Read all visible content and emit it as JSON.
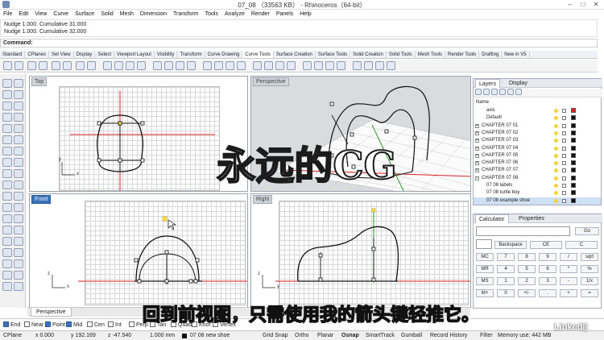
{
  "window": {
    "title": "07_08 （33563 KB） - Rhinoceros（64-bit）",
    "minimize": "–",
    "maximize": "□",
    "close": "✕"
  },
  "menu": [
    "File",
    "Edit",
    "View",
    "Curve",
    "Surface",
    "Solid",
    "Mesh",
    "Dimension",
    "Transform",
    "Tools",
    "Analyze",
    "Render",
    "Panels",
    "Help"
  ],
  "history": [
    "Nudge 1.000. Cumulative 31.000",
    "Nudge 1.000. Cumulative 32.000"
  ],
  "command": {
    "label": "Command:"
  },
  "tabs": [
    "Standard",
    "CPlanes",
    "Set View",
    "Display",
    "Select",
    "Viewport Layout",
    "Visibility",
    "Transform",
    "Curve Drawing",
    "Curve Tools",
    "Surface Creation",
    "Surface Tools",
    "Solid Creation",
    "Solid Tools",
    "Mesh Tools",
    "Render Tools",
    "Drafting",
    "New in V5"
  ],
  "active_tab": "Curve Tools",
  "viewports": {
    "top": "Top",
    "perspective": "Perspective",
    "front": "Front",
    "right": "Right"
  },
  "axis_labels": {
    "x": "x",
    "y": "y",
    "z": "z"
  },
  "viewport_tab": "Perspective",
  "layers_panel": {
    "tabs": [
      "Layers",
      "Display"
    ],
    "header": "Name",
    "rows": [
      {
        "name": "axis",
        "color": "#e81c1c",
        "sel": false,
        "indent": true,
        "expand": ""
      },
      {
        "name": "Default",
        "color": "#111111",
        "sel": false,
        "indent": true,
        "expand": ""
      },
      {
        "name": "CHAPTER 07 01",
        "color": "#111111",
        "sel": false,
        "indent": false,
        "expand": "+"
      },
      {
        "name": "CHAPTER 07 02",
        "color": "#111111",
        "sel": false,
        "indent": false,
        "expand": "+"
      },
      {
        "name": "CHAPTER 07 03",
        "color": "#111111",
        "sel": false,
        "indent": false,
        "expand": "+"
      },
      {
        "name": "CHAPTER 07 04",
        "color": "#111111",
        "sel": false,
        "indent": false,
        "expand": "+"
      },
      {
        "name": "CHAPTER 07 05",
        "color": "#111111",
        "sel": false,
        "indent": false,
        "expand": "+"
      },
      {
        "name": "CHAPTER 07 06",
        "color": "#111111",
        "sel": false,
        "indent": false,
        "expand": "+"
      },
      {
        "name": "CHAPTER 07 07",
        "color": "#111111",
        "sel": false,
        "indent": false,
        "expand": "+"
      },
      {
        "name": "CHAPTER 07 08",
        "color": "#111111",
        "sel": false,
        "indent": false,
        "expand": "−"
      },
      {
        "name": "07 08 labels",
        "color": "#111111",
        "sel": false,
        "indent": true,
        "expand": ""
      },
      {
        "name": "07 08 turtle boy",
        "color": "#111111",
        "sel": false,
        "indent": true,
        "expand": ""
      },
      {
        "name": "07 08 example shoe",
        "color": "#111111",
        "sel": true,
        "indent": true,
        "expand": ""
      }
    ]
  },
  "calc_panel": {
    "tabs": [
      "Calculator",
      "Properties"
    ],
    "go": "Go",
    "buttons": [
      [
        "Backspace",
        "CE",
        "C"
      ],
      [
        "MC",
        "7",
        "8",
        "9",
        "/",
        "sqrt"
      ],
      [
        "MR",
        "4",
        "5",
        "6",
        "*",
        "%"
      ],
      [
        "MS",
        "1",
        "2",
        "3",
        "-",
        "1/x"
      ],
      [
        "M+",
        "0",
        "+/-",
        ".",
        "+",
        "="
      ]
    ]
  },
  "osnap": {
    "items": [
      {
        "label": "End",
        "checked": true
      },
      {
        "label": "Near",
        "checked": false
      },
      {
        "label": "Point",
        "checked": true
      },
      {
        "label": "Mid",
        "checked": true
      },
      {
        "label": "Cen",
        "checked": false
      },
      {
        "label": "Int",
        "checked": false
      },
      {
        "label": "Perp",
        "checked": false
      },
      {
        "label": "Tan",
        "checked": false
      },
      {
        "label": "Quad",
        "checked": false
      },
      {
        "label": "Knot",
        "checked": false
      },
      {
        "label": "Vertex",
        "checked": false
      }
    ]
  },
  "status": {
    "cplane": "CPlane",
    "x": "x 0.000",
    "y": "y 192.169",
    "z": "z -47.540",
    "units": "1.000 mm",
    "layer": "07 08 new shoe",
    "grid_snap": "Grid Snap",
    "ortho": "Ortho",
    "planar": "Planar",
    "osnap": "Osnap",
    "smarttrack": "SmartTrack",
    "gumball": "Gumball",
    "record": "Record History",
    "filter": "Filter",
    "memory": "Memory use: 442 MB"
  },
  "overlay": {
    "watermark": "永远的CG",
    "subtitle": "回到前视图，只需使用我的箭头键轻推它。",
    "brand": "Linked▯"
  }
}
